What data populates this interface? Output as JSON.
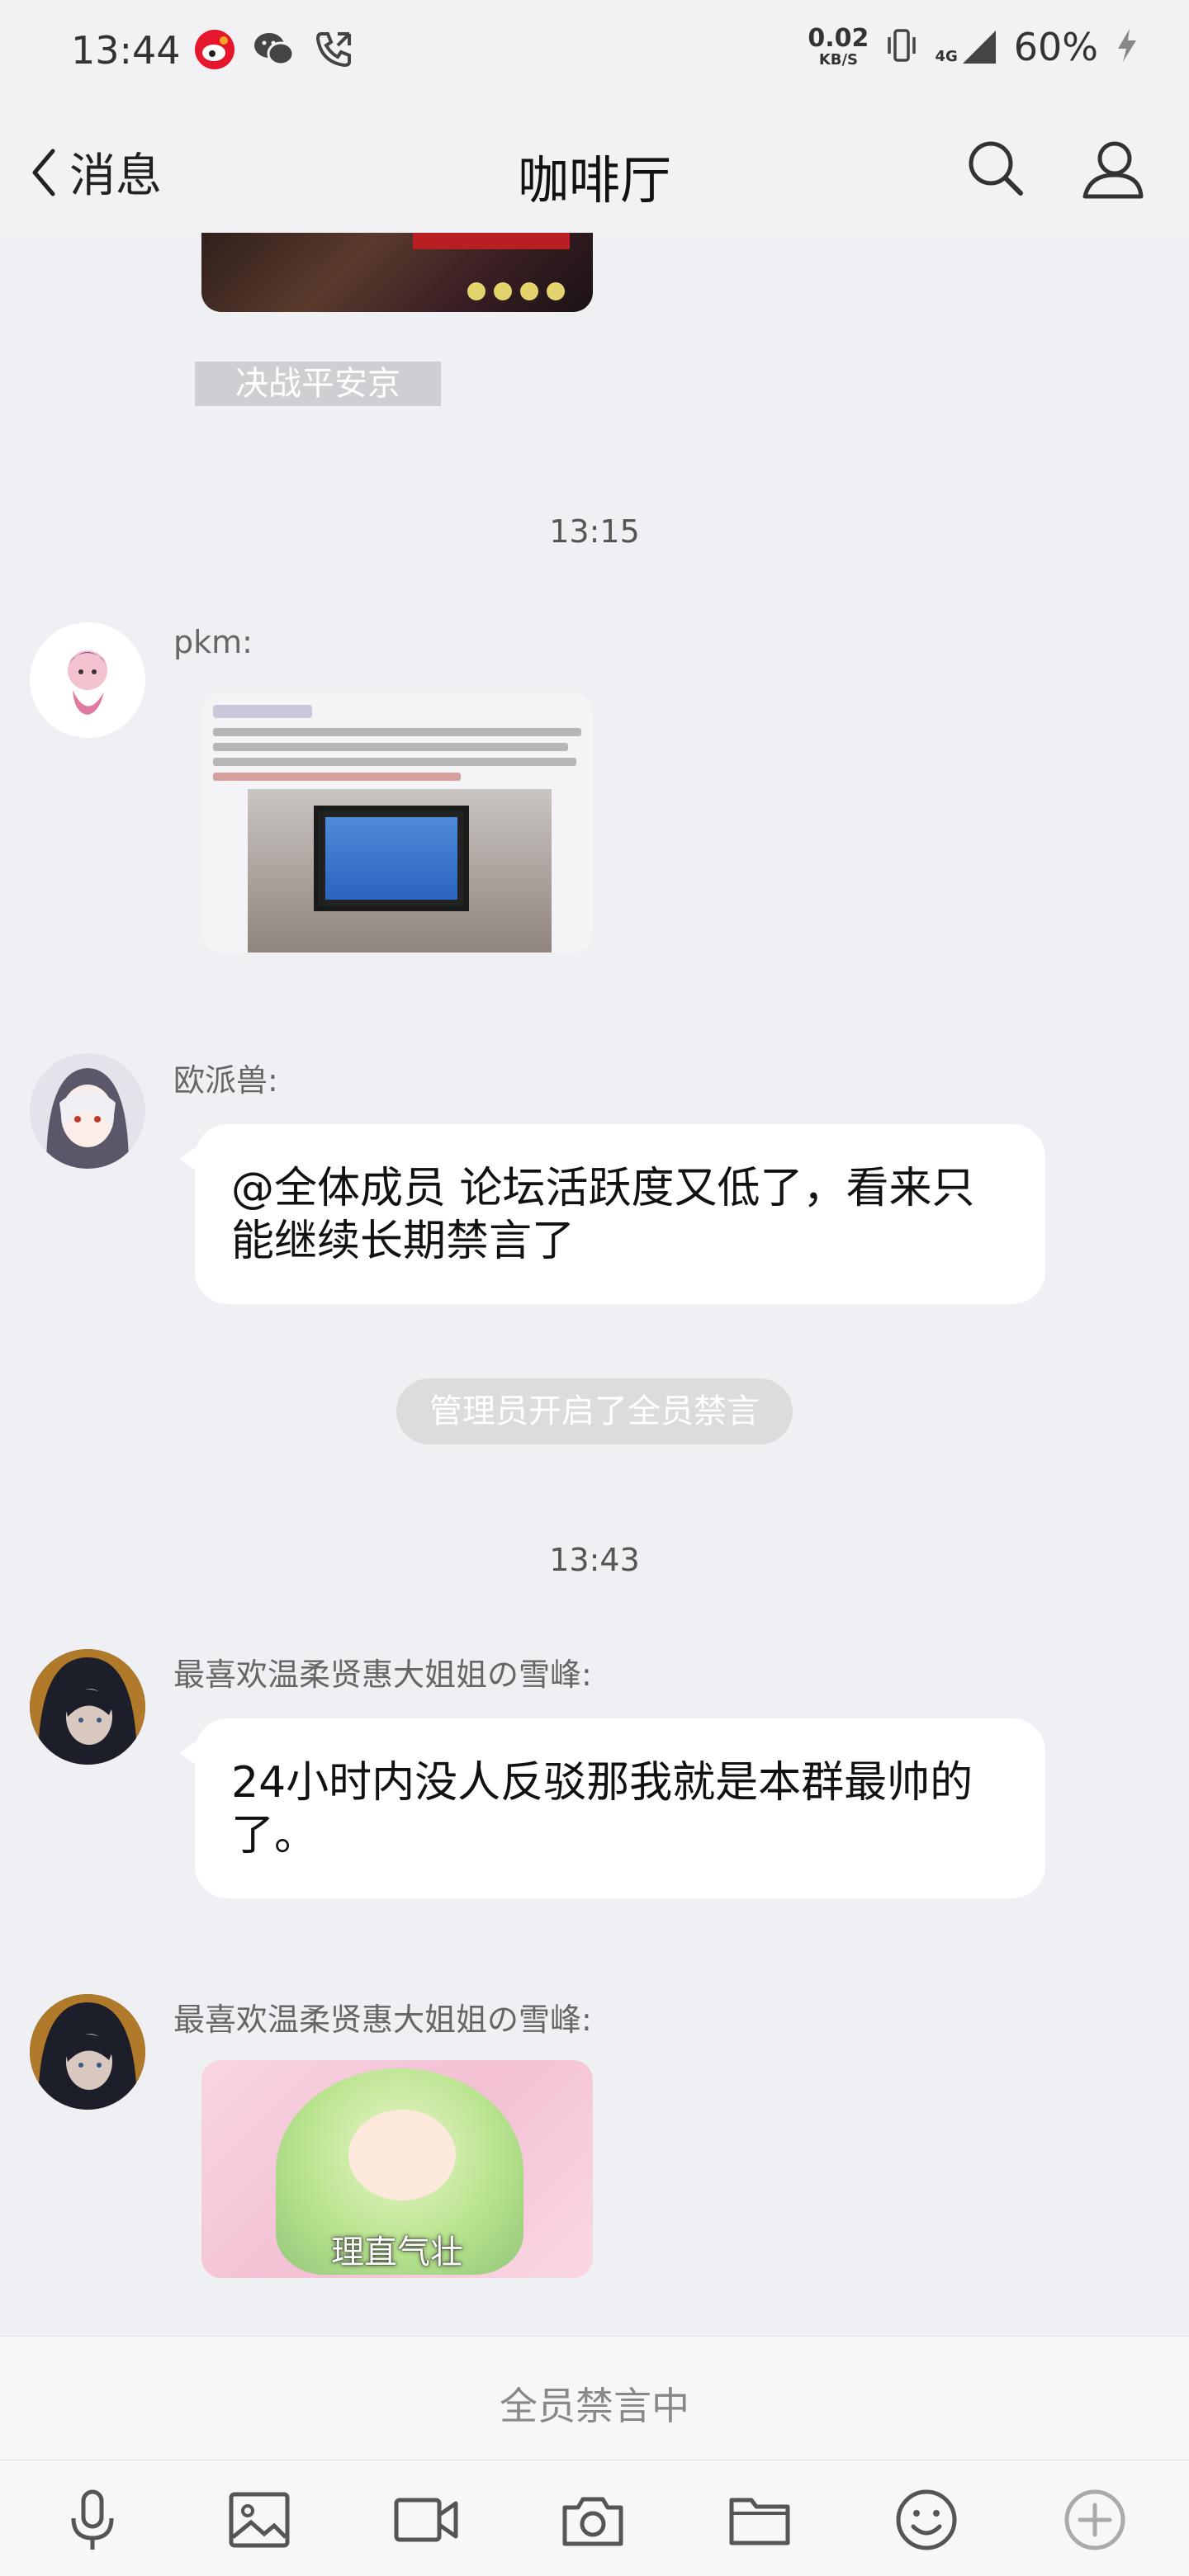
{
  "status_bar": {
    "time": "13:44",
    "speed_value": "0.02",
    "speed_unit": "KB/S",
    "network": "4G",
    "battery": "60%"
  },
  "nav": {
    "back_label": "消息",
    "title": "咖啡厅"
  },
  "chat": {
    "top_image_tag": "决战平安京",
    "timestamps": [
      "13:15",
      "13:43"
    ],
    "messages": [
      {
        "sender": "pkm:",
        "type": "image"
      },
      {
        "sender": "欧派兽:",
        "type": "text",
        "text": "@全体成员 论坛活跃度又低了，看来只能继续长期禁言了"
      },
      {
        "sender": "最喜欢温柔贤惠大姐姐の雪峰:",
        "type": "text",
        "text": "24小时内没人反驳那我就是本群最帅的了。"
      },
      {
        "sender": "最喜欢温柔贤惠大姐姐の雪峰:",
        "type": "sticker",
        "caption": "理直气壮"
      }
    ],
    "system_notice": "管理员开启了全员禁言"
  },
  "mute_status": "全员禁言中",
  "toolbar_icons": [
    "microphone-icon",
    "image-icon",
    "video-icon",
    "camera-icon",
    "folder-icon",
    "emoji-icon",
    "plus-icon"
  ],
  "colors": {
    "background": "#eff0f4",
    "bubble": "#ffffff",
    "icon": "#555555"
  }
}
